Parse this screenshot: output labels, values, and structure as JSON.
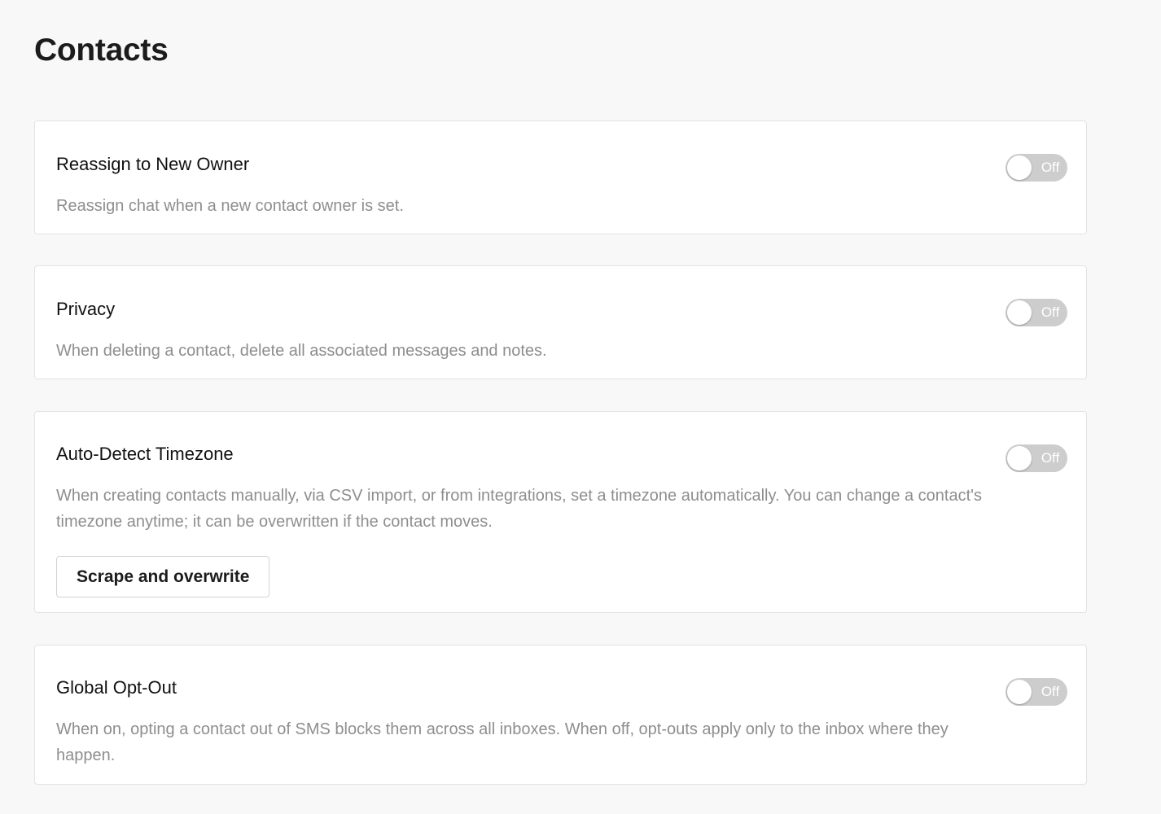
{
  "page": {
    "title": "Contacts"
  },
  "settings": [
    {
      "title": "Reassign to New Owner",
      "description": "Reassign chat when a new contact owner is set.",
      "toggle": {
        "state": "off",
        "label": "Off"
      }
    },
    {
      "title": "Privacy",
      "description": "When deleting a contact, delete all associated messages and notes.",
      "toggle": {
        "state": "off",
        "label": "Off"
      }
    },
    {
      "title": "Auto-Detect Timezone",
      "description": "When creating contacts manually, via CSV import, or from integrations, set a timezone automatically. You can change a contact's timezone anytime; it can be overwritten if the contact moves.",
      "toggle": {
        "state": "off",
        "label": "Off"
      },
      "button_label": "Scrape and overwrite"
    },
    {
      "title": "Global Opt-Out",
      "description": "When on, opting a contact out of SMS blocks them across all inboxes. When off, opt-outs apply only to the inbox where they happen.",
      "toggle": {
        "state": "off",
        "label": "Off"
      }
    }
  ],
  "colors": {
    "background": "#f8f8f8",
    "card": "#ffffff",
    "toggle_off": "#cdcdcd",
    "description_text": "#8e8e8e"
  }
}
